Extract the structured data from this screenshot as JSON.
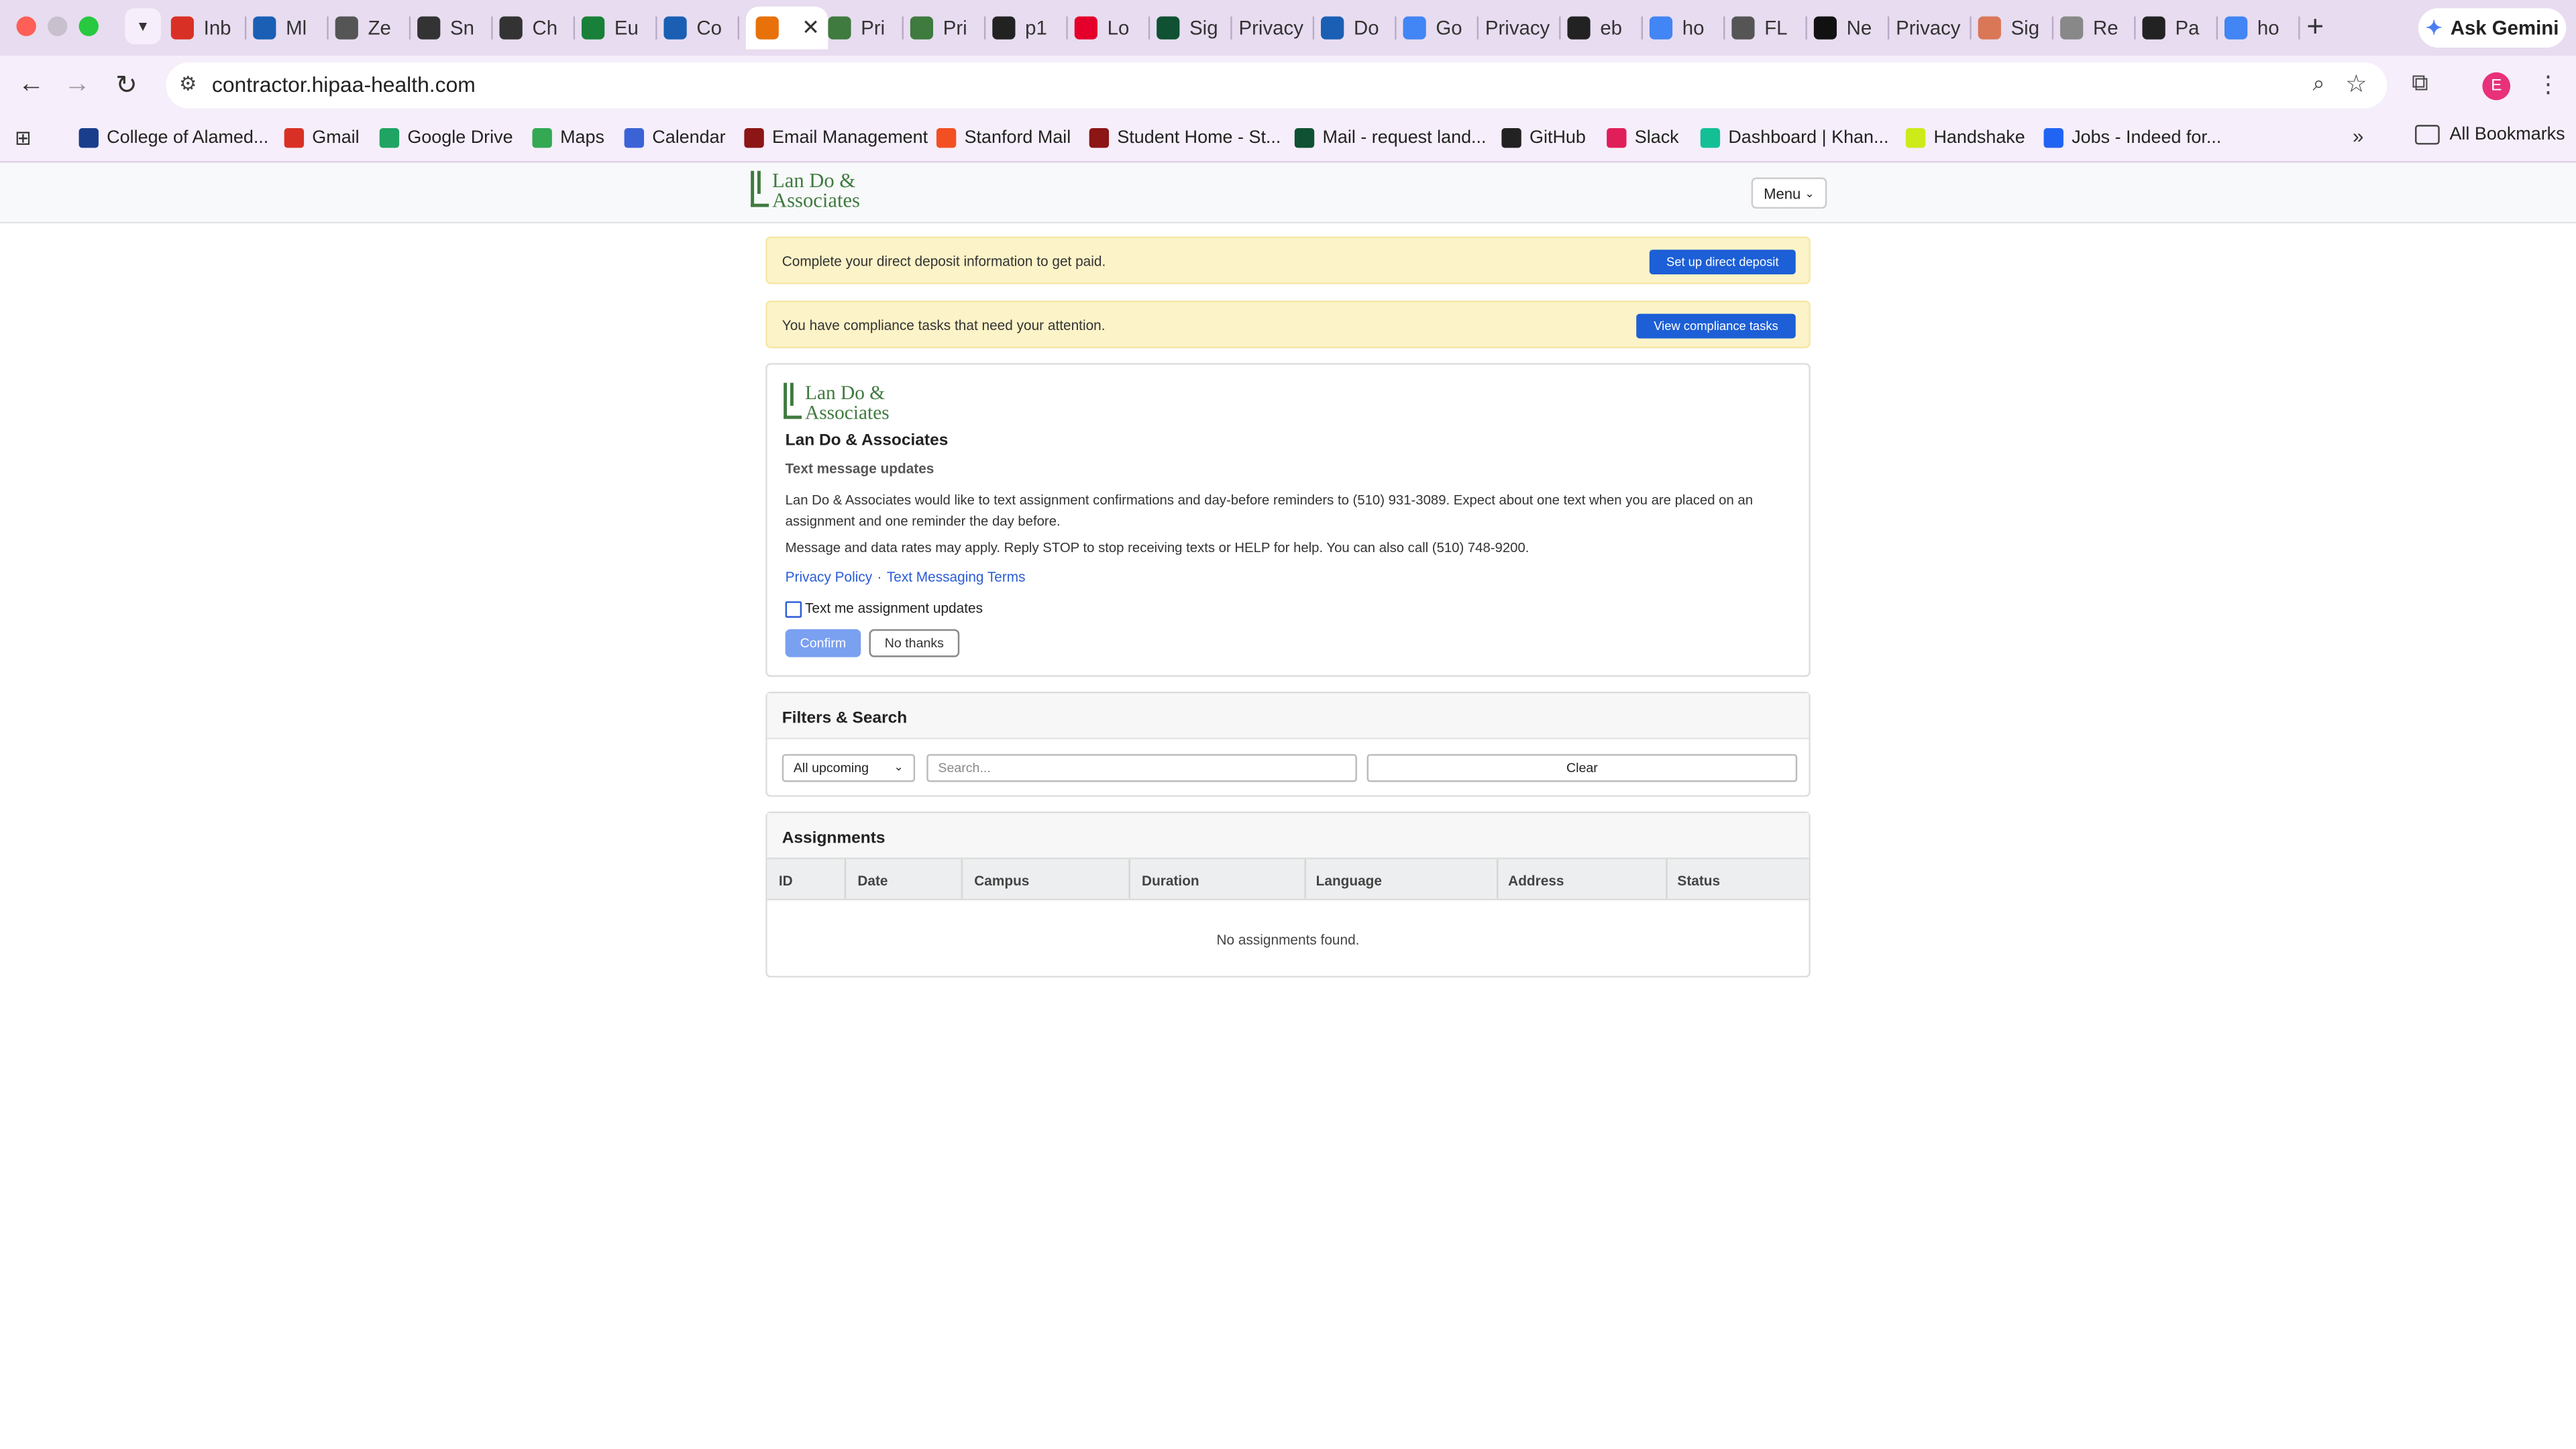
{
  "browser": {
    "tabs": [
      {
        "label": "Inb",
        "icon": "gmail-icon",
        "color": "#d93025"
      },
      {
        "label": "Ml",
        "icon": "h-icon",
        "color": "#1a5fb4"
      },
      {
        "label": "Ze",
        "icon": "globe-icon",
        "color": "#555555"
      },
      {
        "label": "Sn",
        "icon": "chatgpt-icon",
        "color": "#333333"
      },
      {
        "label": "Ch",
        "icon": "chatgpt-icon",
        "color": "#333333"
      },
      {
        "label": "Eu",
        "icon": "sheets-icon",
        "color": "#188038"
      },
      {
        "label": "Co",
        "icon": "h-icon",
        "color": "#1a5fb4"
      },
      {
        "label": "",
        "icon": "h-icon",
        "color": "#e8710a"
      },
      {
        "label": "Pri",
        "icon": "l-icon",
        "color": "#3f7a3f"
      },
      {
        "label": "Pri",
        "icon": "l-icon",
        "color": "#3f7a3f"
      },
      {
        "label": "p1",
        "icon": "github-icon",
        "color": "#222222"
      },
      {
        "label": "Lo",
        "icon": "target-icon",
        "color": "#e4002b"
      },
      {
        "label": "Sig",
        "icon": "ns-icon",
        "color": "#0f5132"
      },
      {
        "label": "Privacy",
        "icon": "",
        "color": ""
      },
      {
        "label": "Do",
        "icon": "h-icon",
        "color": "#1a5fb4"
      },
      {
        "label": "Go",
        "icon": "key-icon",
        "color": "#4285f4"
      },
      {
        "label": "Privacy",
        "icon": "",
        "color": ""
      },
      {
        "label": "eb",
        "icon": "github-icon",
        "color": "#222222"
      },
      {
        "label": "ho",
        "icon": "google-icon",
        "color": "#4285f4"
      },
      {
        "label": "FL",
        "icon": "globe-icon",
        "color": "#555555"
      },
      {
        "label": "Ne",
        "icon": "pattern-icon",
        "color": "#111111"
      },
      {
        "label": "Privacy",
        "icon": "",
        "color": ""
      },
      {
        "label": "Sig",
        "icon": "claude-icon",
        "color": "#d97757"
      },
      {
        "label": "Re",
        "icon": "globe-icon",
        "color": "#888888"
      },
      {
        "label": "Pa",
        "icon": "github-icon",
        "color": "#222222"
      },
      {
        "label": "ho",
        "icon": "google-icon",
        "color": "#4285f4"
      }
    ],
    "ask_gemini": "Ask Gemini",
    "url": "contractor.hipaa-health.com",
    "profile_initial": "E",
    "bookmarks": [
      {
        "label": "College of Alamed...",
        "icon": "college-icon",
        "color": "#1a3e8c"
      },
      {
        "label": "Gmail",
        "icon": "gmail-icon",
        "color": "#d93025"
      },
      {
        "label": "Google Drive",
        "icon": "drive-icon",
        "color": "#1fa463"
      },
      {
        "label": "Maps",
        "icon": "maps-icon",
        "color": "#34a853"
      },
      {
        "label": "Calendar",
        "icon": "calendar-icon",
        "color": "#3b63d6"
      },
      {
        "label": "Email Management",
        "icon": "stanford-icon",
        "color": "#8c1515"
      },
      {
        "label": "Stanford Mail",
        "icon": "microsoft-icon",
        "color": "#f25022"
      },
      {
        "label": "Student Home - St...",
        "icon": "stanford-icon",
        "color": "#8c1515"
      },
      {
        "label": "Mail - request land...",
        "icon": "ns-icon",
        "color": "#0f5132"
      },
      {
        "label": "GitHub",
        "icon": "github-icon",
        "color": "#222222"
      },
      {
        "label": "Slack",
        "icon": "slack-icon",
        "color": "#e01e5a"
      },
      {
        "label": "Dashboard | Khan...",
        "icon": "khan-icon",
        "color": "#14bf96"
      },
      {
        "label": "Handshake",
        "icon": "handshake-icon",
        "color": "#cdea19"
      },
      {
        "label": "Jobs - Indeed for...",
        "icon": "indeed-icon",
        "color": "#2164f3"
      }
    ],
    "all_bookmarks": "All Bookmarks"
  },
  "header": {
    "logo_line1": "Lan Do &",
    "logo_line2": "Associates",
    "menu_label": "Menu"
  },
  "alerts": [
    {
      "message": "Complete your direct deposit information to get paid.",
      "button": "Set up direct deposit"
    },
    {
      "message": "You have compliance tasks that need your attention.",
      "button": "View compliance tasks"
    }
  ],
  "sms_card": {
    "logo_line1": "Lan Do &",
    "logo_line2": "Associates",
    "org_name": "Lan Do & Associates",
    "subtitle": "Text message updates",
    "paragraph1": "Lan Do & Associates would like to text assignment confirmations and day-before reminders to (510) 931-3089. Expect about one text when you are placed on an assignment and one reminder the day before.",
    "paragraph2": "Message and data rates may apply. Reply STOP to stop receiving texts or HELP for help. You can also call (510) 748-9200.",
    "privacy_link": "Privacy Policy",
    "link_separator": "·",
    "terms_link": "Text Messaging Terms",
    "checkbox_label": "Text me assignment updates",
    "checkbox_checked": false,
    "confirm_label": "Confirm",
    "no_thanks_label": "No thanks"
  },
  "filters": {
    "title": "Filters & Search",
    "select_value": "All upcoming",
    "search_placeholder": "Search...",
    "clear_label": "Clear"
  },
  "assignments": {
    "title": "Assignments",
    "columns": [
      "ID",
      "Date",
      "Campus",
      "Duration",
      "Language",
      "Address",
      "Status"
    ],
    "empty_message": "No assignments found."
  }
}
